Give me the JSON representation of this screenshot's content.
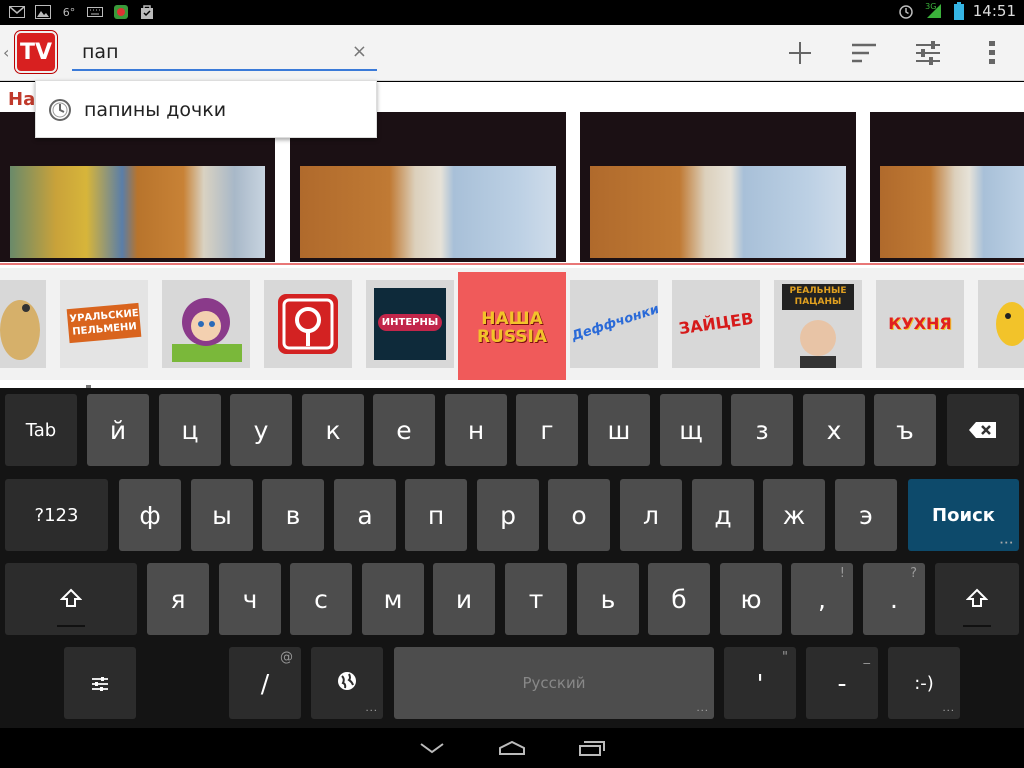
{
  "status_bar": {
    "temperature": "6°",
    "network": "3G",
    "time": "14:51"
  },
  "app_bar": {
    "logo_text": "TV",
    "search_value": "пап",
    "clear_glyph": "×"
  },
  "autocomplete": {
    "suggestion": "папины дочки"
  },
  "content": {
    "section_label": "На"
  },
  "channels": {
    "labels": [
      "УРАЛЬСКИЕ ПЕЛЬМЕНИ",
      "ИНТЕРНЫ",
      "НАША RUSSIA",
      "Деффчонки",
      "ЗАЙЦЕВ",
      "РЕАЛЬНЫЕ ПАЦАНЫ",
      "КУХНЯ"
    ]
  },
  "keyboard": {
    "row1": [
      "Tab",
      "й",
      "ц",
      "у",
      "к",
      "е",
      "н",
      "г",
      "ш",
      "щ",
      "з",
      "х",
      "ъ"
    ],
    "row2": [
      "?123",
      "ф",
      "ы",
      "в",
      "а",
      "п",
      "р",
      "о",
      "л",
      "д",
      "ж",
      "э",
      "Поиск"
    ],
    "row3": [
      "я",
      "ч",
      "с",
      "м",
      "и",
      "т",
      "ь",
      "б",
      "ю",
      ",",
      "."
    ],
    "row3_hints": [
      "!",
      "?"
    ],
    "row4": {
      "slash": "/",
      "slash_hint": "@",
      "space": "Русский",
      "apostrophe": "'",
      "apostrophe_hint": "\"",
      "dash": "-",
      "dash_hint": "_",
      "smiley": ":-)"
    }
  },
  "colors": {
    "accent_blue": "#3a7ad8",
    "search_key": "#0d4a6b",
    "logo_red": "#d82020",
    "section_red": "#c0392b"
  }
}
